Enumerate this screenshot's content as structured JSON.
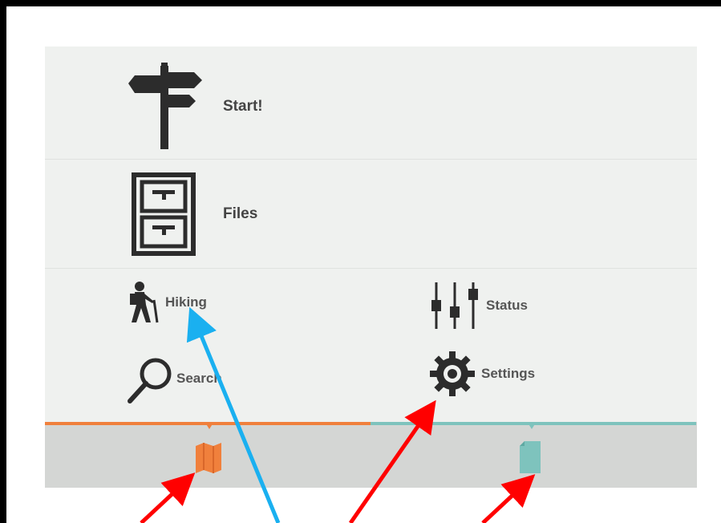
{
  "menu": {
    "start_label": "Start!",
    "files_label": "Files"
  },
  "grid": {
    "hiking_label": "Hiking",
    "status_label": "Status",
    "search_label": "Search",
    "settings_label": "Settings"
  },
  "tabs": [
    {
      "icon": "map-icon",
      "accent": "#f0803c"
    },
    {
      "icon": "document-icon",
      "accent": "#7ec3bd"
    }
  ],
  "annotation_colors": {
    "red": "#ff0000",
    "blue": "#1ab0f0"
  },
  "icon_color": "#2c2c2c"
}
